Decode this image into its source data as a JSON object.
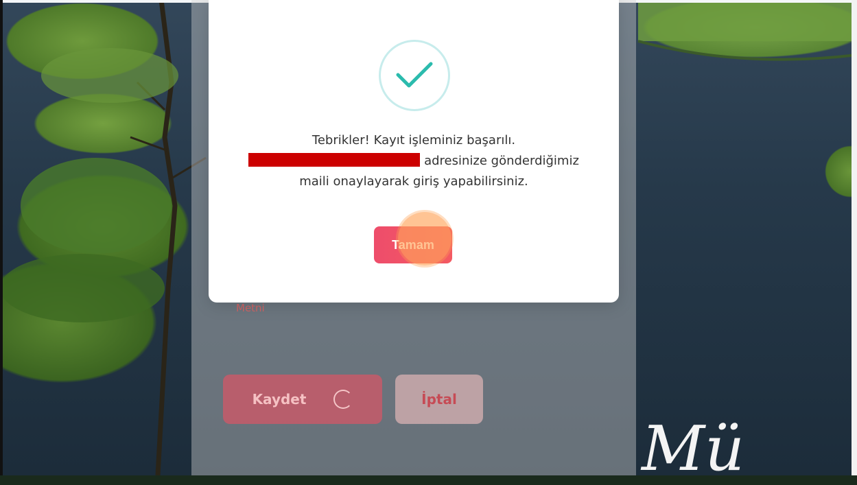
{
  "modal": {
    "line1": "Tebrikler! Kayıt işleminiz başarılı.",
    "line2_suffix": "adresinize gönderdiğimiz",
    "line3": "maili onaylayarak giriş yapabilirsiniz.",
    "ok_label": "Tamam",
    "icon": "check-icon",
    "accent": "#2bbbad"
  },
  "form": {
    "field_label": "Metni",
    "save_label": "Kaydet",
    "cancel_label": "İptal"
  },
  "colors": {
    "primary_button": "#ee4d6b",
    "redaction": "#cc0000",
    "click_indicator": "#ffa55a"
  }
}
